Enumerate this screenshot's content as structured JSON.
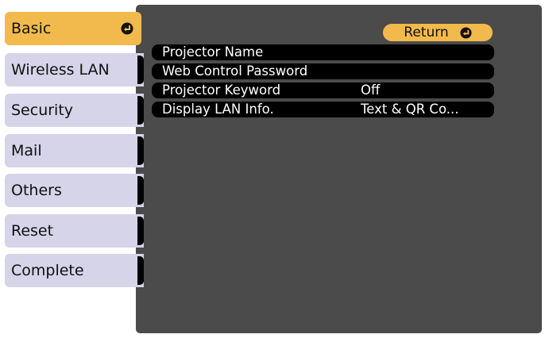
{
  "sidebar": {
    "items": [
      {
        "label": "Basic",
        "active": true
      },
      {
        "label": "Wireless LAN"
      },
      {
        "label": "Security"
      },
      {
        "label": "Mail"
      },
      {
        "label": "Others"
      },
      {
        "label": "Reset"
      },
      {
        "label": "Complete"
      }
    ],
    "enter_icon": "enter-icon"
  },
  "header": {
    "return_label": "Return",
    "return_icon": "enter-icon"
  },
  "settings": [
    {
      "label": "Projector Name",
      "value": ""
    },
    {
      "label": "Web Control Password",
      "value": ""
    },
    {
      "label": "Projector Keyword",
      "value": "Off"
    },
    {
      "label": "Display LAN Info.",
      "value": "Text & QR Co..."
    }
  ],
  "colors": {
    "accent": "#f2ba4c",
    "tab_background": "#d5d4e9",
    "panel": "#4b4b4b",
    "row": "#000000"
  }
}
